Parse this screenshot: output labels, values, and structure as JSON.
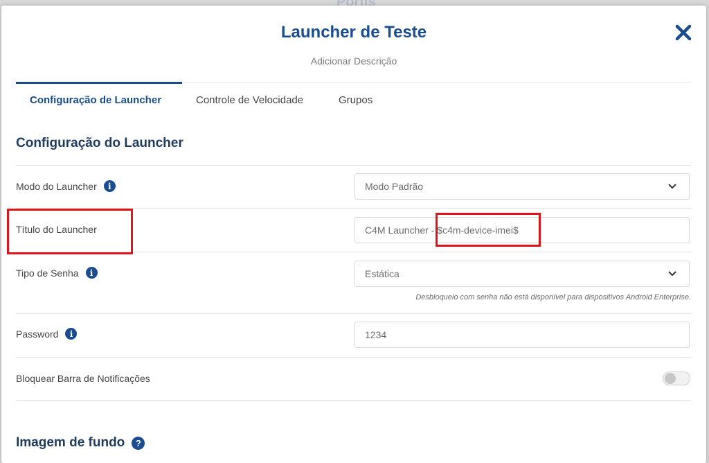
{
  "background_title": "Portis",
  "modal": {
    "title": "Launcher de Teste",
    "subtitle": "Adicionar Descrição",
    "close_icon": "close-icon"
  },
  "tabs": [
    {
      "label": "Configuração de Launcher",
      "active": true
    },
    {
      "label": "Controle de Velocidade",
      "active": false
    },
    {
      "label": "Grupos",
      "active": false
    }
  ],
  "section_config": {
    "title": "Configuração do Launcher",
    "rows": {
      "mode": {
        "label": "Modo do Launcher",
        "value": "Modo Padrão",
        "icon": "info-icon"
      },
      "title": {
        "label": "Título do Launcher",
        "value_prefix": "C4M Launcher - ",
        "value_var": "$c4m-device-imei$"
      },
      "password_type": {
        "label": "Tipo de Senha",
        "value": "Estática",
        "icon": "info-icon",
        "hint": "Desbloqueio com senha não está disponível para dispositivos Android Enterprise."
      },
      "password": {
        "label": "Password",
        "value": "1234",
        "icon": "info-icon"
      },
      "block_notifications": {
        "label": "Bloquear Barra de Notificações",
        "enabled": false
      }
    }
  },
  "section_background": {
    "title": "Imagem de fundo",
    "icon": "help-icon"
  },
  "colors": {
    "accent": "#1a4d8f",
    "highlight": "#e0141b"
  }
}
